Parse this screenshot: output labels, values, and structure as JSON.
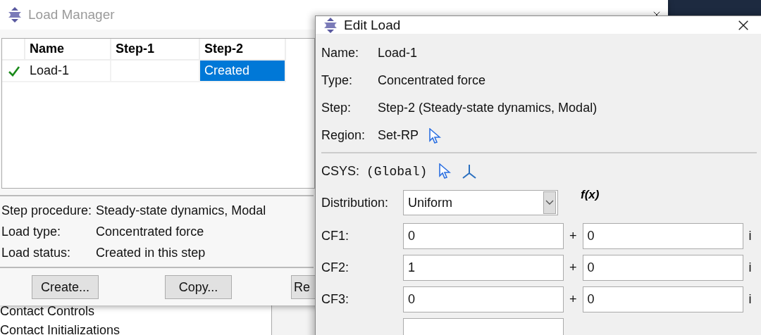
{
  "load_manager": {
    "title": "Load Manager",
    "table": {
      "columns": [
        "Name",
        "Step-1",
        "Step-2"
      ],
      "rows": [
        {
          "checked": true,
          "cells": [
            {
              "text": "Load-1",
              "selected": false
            },
            {
              "selected": false
            },
            {
              "text": "Created",
              "selected": true
            }
          ]
        }
      ]
    },
    "info": [
      {
        "label": "Step procedure:",
        "value": "Steady-state dynamics, Modal"
      },
      {
        "label": "Load type:",
        "value": "Concentrated force"
      },
      {
        "label": "Load status:",
        "value": "Created in this step"
      }
    ],
    "buttons": [
      "Create...",
      "Copy...",
      "Re"
    ]
  },
  "background_tree": [
    "Contact Controls",
    "Contact Initializations"
  ],
  "edit_load": {
    "title": "Edit Load",
    "fields": [
      {
        "kind": "text",
        "label": "Name:",
        "value": "Load-1"
      },
      {
        "kind": "text",
        "label": "Type:",
        "value": "Concentrated force"
      },
      {
        "kind": "text",
        "label": "Step:",
        "value": "Step-2 (Steady-state dynamics, Modal)"
      },
      {
        "kind": "pick",
        "label": "Region:",
        "value": "Set-RP"
      }
    ],
    "csys": {
      "label": "CSYS:",
      "value": "(Global)"
    },
    "distribution": {
      "label": "Distribution:",
      "value": "Uniform",
      "fx": "f(x)"
    },
    "components": [
      {
        "label": "CF1:",
        "real": "0",
        "plus": "+",
        "imag": "0",
        "unit": "i"
      },
      {
        "label": "CF2:",
        "real": "1",
        "plus": "+",
        "imag": "0",
        "unit": "i"
      },
      {
        "label": "CF3:",
        "real": "0",
        "plus": "+",
        "imag": "0",
        "unit": "i"
      }
    ]
  }
}
